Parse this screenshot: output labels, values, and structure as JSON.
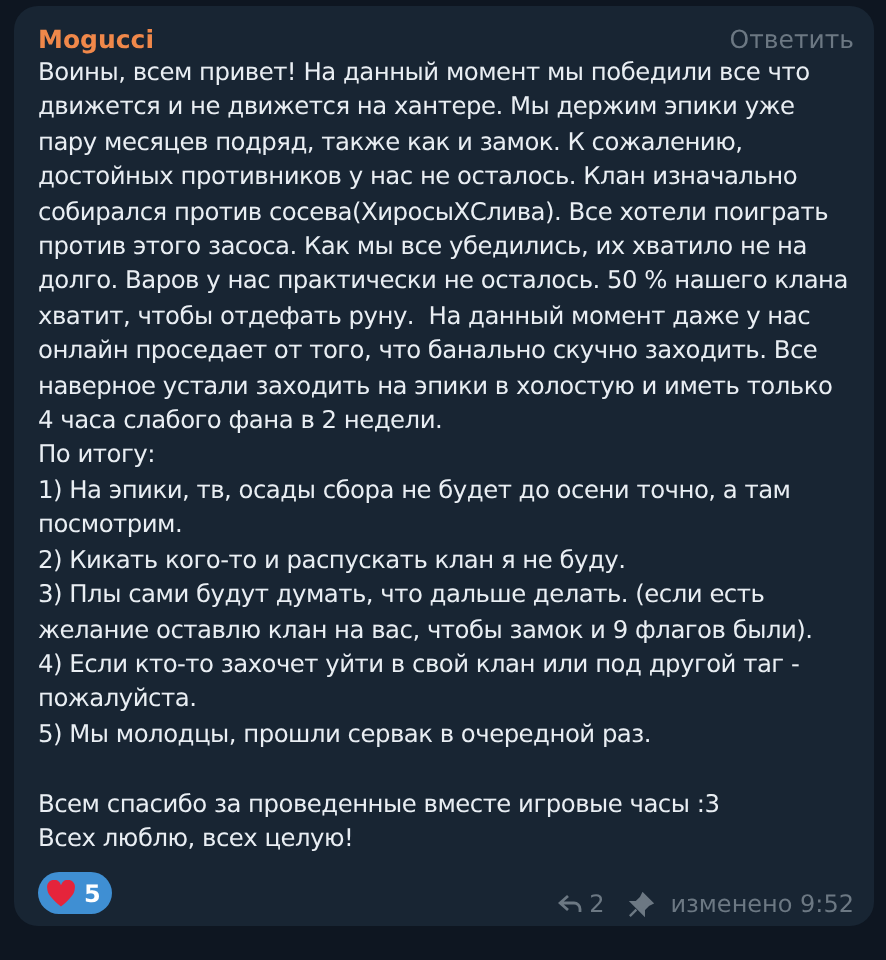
{
  "message": {
    "author": "Mogucci",
    "reply_label": "Ответить",
    "text": "Воины, всем привет! На данный момент мы победили все что движется и не движется на хантере. Мы держим эпики уже пару месяцев подряд, также как и замок. К сожалению, достойных противников у нас не осталось. Клан изначально собирался против сосева(ХиросыХСлива). Все хотели поиграть против этого засоса. Как мы все убедились, их хватило не на долго. Варов у нас практически не осталось. 50 % нашего клана хватит, чтобы отдефать руну.  На данный момент даже у нас онлайн проседает от того, что банально скучно заходить. Все наверное устали заходить на эпики в холостую и иметь только 4 часа слабого фана в 2 недели.\nПо итогу:\n1) На эпики, тв, осады сбора не будет до осени точно, а там посмотрим.\n2) Кикать кого-то и распускать клан я не буду.\n3) Плы сами будут думать, что дальше делать. (если есть желание оставлю клан на вас, чтобы замок и 9 флагов были).\n4) Если кто-то захочет уйти в свой клан или под другой таг - пожалуйста.\n5) Мы молодцы, прошли сервак в очередной раз.\n\nВсем спасибо за проведенные вместе игровые часы :3\nВсех люблю, всех целую!",
    "reactions": [
      {
        "count": "5",
        "selected": true
      }
    ],
    "replies": "2",
    "pinned": true,
    "status": "изменено 9:52"
  }
}
